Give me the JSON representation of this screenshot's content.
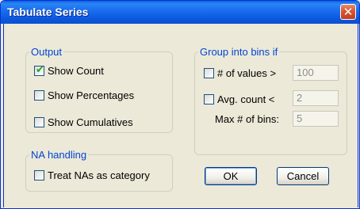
{
  "window": {
    "title": "Tabulate Series"
  },
  "output": {
    "legend": "Output",
    "show_count": {
      "label": "Show Count",
      "checked": true
    },
    "show_percentages": {
      "label": "Show Percentages",
      "checked": false
    },
    "show_cumulatives": {
      "label": "Show Cumulatives",
      "checked": false
    }
  },
  "bins": {
    "legend": "Group into bins if",
    "num_values": {
      "label": "# of values >",
      "checked": false,
      "value": "100"
    },
    "avg_count": {
      "label": "Avg. count <",
      "checked": false,
      "value": "2"
    },
    "max_bins": {
      "label": "Max # of bins:",
      "value": "5"
    }
  },
  "na": {
    "legend": "NA handling",
    "treat_nas": {
      "label": "Treat NAs as category",
      "checked": false
    }
  },
  "buttons": {
    "ok": "OK",
    "cancel": "Cancel"
  },
  "colors": {
    "titlebar": "#0b57dc",
    "group_legend": "#0046d5",
    "dialog_bg": "#ece9d8"
  }
}
